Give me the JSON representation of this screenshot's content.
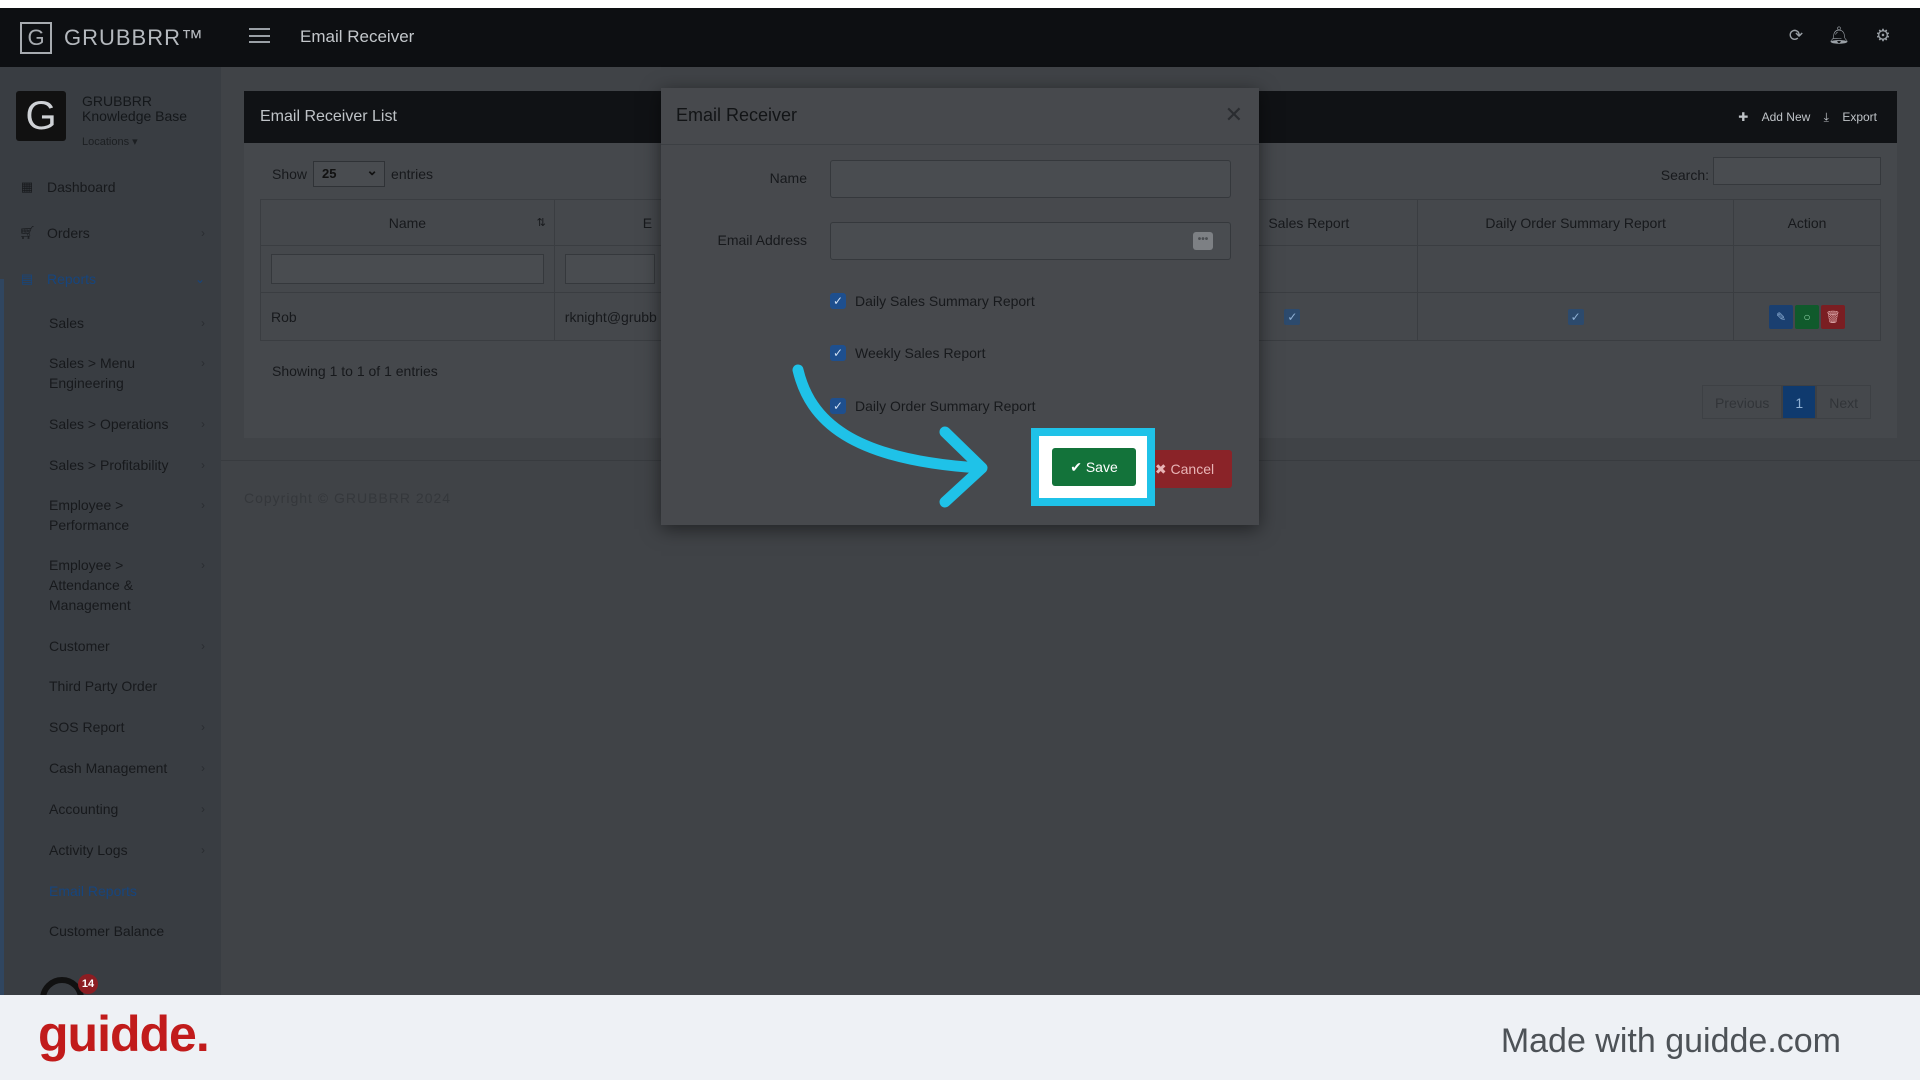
{
  "brand": {
    "mark": "G",
    "name": "GRUBBRR™"
  },
  "header": {
    "title": "Email Receiver"
  },
  "profile": {
    "name": "GRUBBRR Knowledge Base",
    "locations": "Locations"
  },
  "sidebar": {
    "dashboard": "Dashboard",
    "orders": "Orders",
    "reports": "Reports",
    "sub": [
      "Sales",
      "Sales > Menu Engineering",
      "Sales > Operations",
      "Sales > Profitability",
      "Employee > Performance",
      "Employee > Attendance & Management",
      "Customer",
      "Third Party Order",
      "SOS Report",
      "Cash Management",
      "Accounting",
      "Activity Logs",
      "Email Reports",
      "Customer Balance"
    ],
    "badge": "14"
  },
  "panel": {
    "title": "Email Receiver List",
    "add_new": "Add New",
    "export": "Export",
    "show_label": "Show",
    "page_size": "25",
    "entries_label": "entries",
    "search_label": "Search:",
    "columns": [
      "Name",
      "E",
      "Sales Report",
      "Daily Order Summary Report",
      "Action"
    ],
    "rows": [
      {
        "name": "Rob",
        "email": "rknight@grubb"
      }
    ],
    "showing": "Showing 1 to 1 of 1 entries",
    "pager": {
      "previous": "Previous",
      "current": "1",
      "next": "Next"
    }
  },
  "copyright": "Copyright © GRUBBRR 2024",
  "modal": {
    "title": "Email Receiver",
    "name_label": "Name",
    "email_label": "Email Address",
    "name_value": "",
    "email_value": "",
    "checkboxes": [
      {
        "label": "Daily Sales Summary Report",
        "checked": true
      },
      {
        "label": "Weekly Sales Report",
        "checked": true
      },
      {
        "label": "Daily Order Summary Report",
        "checked": true
      }
    ],
    "save": "Save",
    "cancel": "Cancel"
  },
  "footer": {
    "logo": "guidde.",
    "made_with": "Made with guidde.com"
  },
  "colors": {
    "highlight": "#1fc2e8",
    "save": "#13733a",
    "cancel": "#8a2328",
    "guidde": "#c11b1b"
  }
}
